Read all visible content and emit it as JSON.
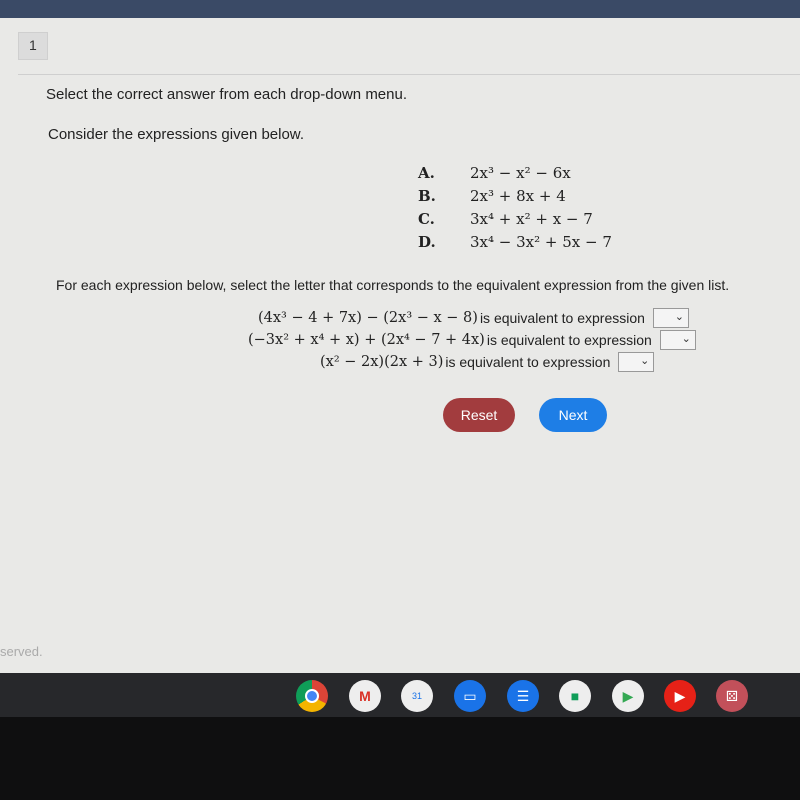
{
  "question_number": "1",
  "instruction": "Select the correct answer from each drop-down menu.",
  "prompt": "Consider the expressions given below.",
  "options": [
    {
      "letter": "A.",
      "expr": "2x³ − x² − 6x"
    },
    {
      "letter": "B.",
      "expr": "2x³ + 8x + 4"
    },
    {
      "letter": "C.",
      "expr": "3x⁴ + x² + x − 7"
    },
    {
      "letter": "D.",
      "expr": "3x⁴ − 3x² + 5x − 7"
    }
  ],
  "for_each": "For each expression below, select the letter that corresponds to the equivalent expression from the given list.",
  "items": [
    {
      "expr": "(4x³ − 4 + 7x) − (2x³ − x − 8)",
      "text": "is equivalent to expression",
      "selected": ""
    },
    {
      "expr": "(−3x² + x⁴ + x) + (2x⁴ − 7 + 4x)",
      "text": "is equivalent to expression",
      "selected": ""
    },
    {
      "expr": "(x² − 2x)(2x + 3)",
      "text": "is equivalent to expression",
      "selected": ""
    }
  ],
  "buttons": {
    "reset": "Reset",
    "next": "Next"
  },
  "footer_text": "served.",
  "shelf_apps": [
    "chrome-icon",
    "gmail-icon",
    "calendar-icon",
    "files-icon",
    "messages-icon",
    "meet-icon",
    "play-store-icon",
    "youtube-icon",
    "app-launcher-icon"
  ],
  "colors": {
    "reset": "#a23c3e",
    "next": "#1e7ee6"
  }
}
